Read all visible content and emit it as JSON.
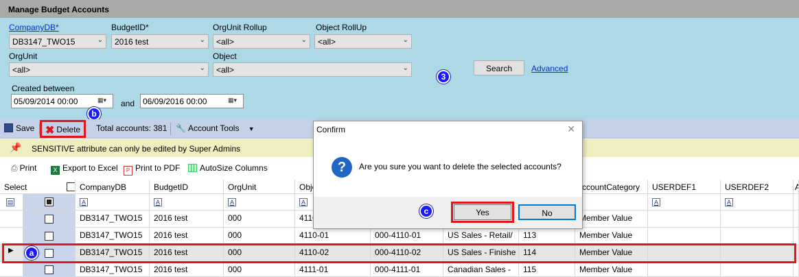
{
  "window": {
    "title": "Manage Budget Accounts"
  },
  "filters": {
    "company_label": "CompanyDB*",
    "company_value": "DB3147_TWO15",
    "budget_label": "BudgetID*",
    "budget_value": "2016 test",
    "orgunit_rollup_label": "OrgUnit Rollup",
    "orgunit_rollup_value": "<all>",
    "object_rollup_label": "Object RollUp",
    "object_rollup_value": "<all>",
    "orgunit_label": "OrgUnit",
    "orgunit_value": "<all>",
    "object_label": "Object",
    "object_value": "<all>",
    "search_label": "Search",
    "advanced_label": "Advanced",
    "created_label": "Created between",
    "date_from": "05/09/2014  00:00",
    "and_label": "and",
    "date_to": "06/09/2016  00:00"
  },
  "markers": {
    "a": "a",
    "b": "b",
    "c": "c",
    "three": "3"
  },
  "toolbar": {
    "save_label": "Save",
    "delete_label": "Delete",
    "total_accounts": "Total accounts: 381",
    "account_tools_label": "Account Tools"
  },
  "notice": {
    "text": "SENSITIVE attribute can only be edited by Super Admins"
  },
  "export": {
    "print_label": "Print",
    "excel_label": "Export to Excel",
    "pdf_label": "Print to PDF",
    "autosize_label": "AutoSize Columns"
  },
  "grid": {
    "headers": {
      "select": "Select",
      "company": "CompanyDB",
      "budget": "BudgetID",
      "orgunit": "OrgUnit",
      "object": "Obje",
      "account_category": "AccountCategory",
      "userdef1": "USERDEF1",
      "userdef2": "USERDEF2",
      "last": "A"
    },
    "rows": [
      {
        "company": "DB3147_TWO15",
        "budget": "2016 test",
        "orgunit": "000",
        "object": "4110",
        "account": "",
        "desc": "",
        "num": "",
        "category": "Member Value"
      },
      {
        "company": "DB3147_TWO15",
        "budget": "2016 test",
        "orgunit": "000",
        "object": "4110-01",
        "account": "000-4110-01",
        "desc": "US Sales - Retail/",
        "num": "113",
        "category": "Member Value"
      },
      {
        "company": "DB3147_TWO15",
        "budget": "2016 test",
        "orgunit": "000",
        "object": "4110-02",
        "account": "000-4110-02",
        "desc": "US Sales - Finishe",
        "num": "114",
        "category": "Member Value"
      },
      {
        "company": "DB3147_TWO15",
        "budget": "2016 test",
        "orgunit": "000",
        "object": "4111-01",
        "account": "000-4111-01",
        "desc": "Canadian Sales -",
        "num": "115",
        "category": "Member Value"
      }
    ]
  },
  "dialog": {
    "title": "Confirm",
    "message": "Are you sure you want to delete the selected accounts?",
    "yes_label": "Yes",
    "no_label": "No"
  },
  "colors": {
    "title_bar": "#a9a9a9",
    "filter_panel": "#add8e6",
    "toolbar": "#c3d2e6",
    "notice": "#efeebf",
    "highlight": "#e3141b",
    "marker": "#1a1aff"
  }
}
